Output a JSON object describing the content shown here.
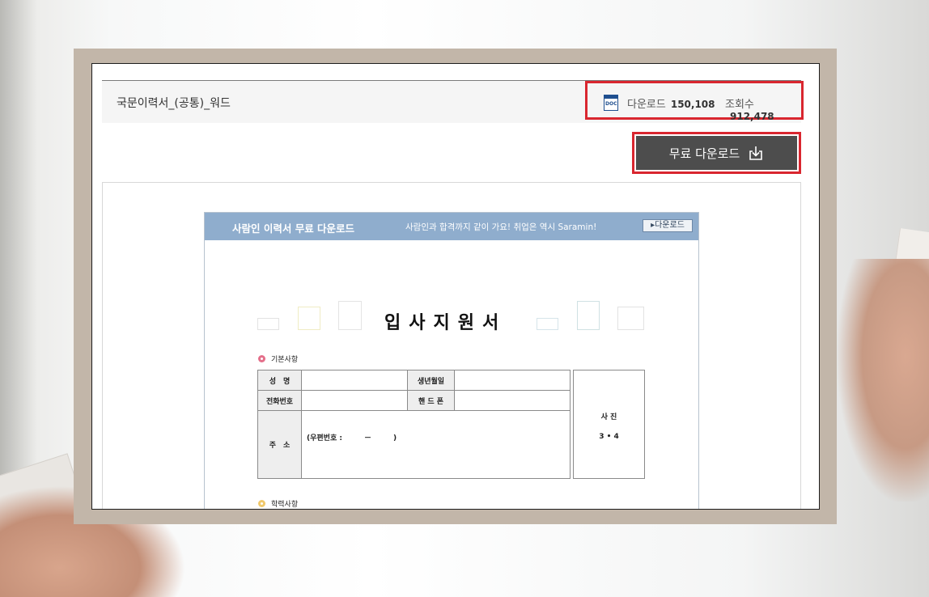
{
  "document": {
    "title": "국문이력서_(공통)_워드",
    "file_type": "DOC"
  },
  "stats": {
    "download_label": "다운로드",
    "download_count": "150,108",
    "views_label": "조회수",
    "views_count": "912,478"
  },
  "download_button": {
    "label": "무료 다운로드",
    "icon": "download-icon"
  },
  "preview": {
    "banner_title": "사람인 이력서 무료 다운로드",
    "banner_subtitle": "사람인과 합격까지 같이 가요! 취업은 역시 Saramin!",
    "banner_button": "▸다운로드",
    "form_title": "입사지원서",
    "section_basic": "기본사항",
    "section_education": "학력사항",
    "fields": {
      "name": "성　명",
      "birth": "생년월일",
      "phone": "전화번호",
      "mobile": "핸 드 폰",
      "address": "주　소",
      "address_value": "(우편번호 :　　　－　　　)"
    },
    "photo_label": "사 진",
    "photo_size": "3 • 4"
  },
  "colors": {
    "highlight": "#d9262f",
    "button_bg": "#4d4d4d",
    "banner_bg": "#8fadcd"
  }
}
